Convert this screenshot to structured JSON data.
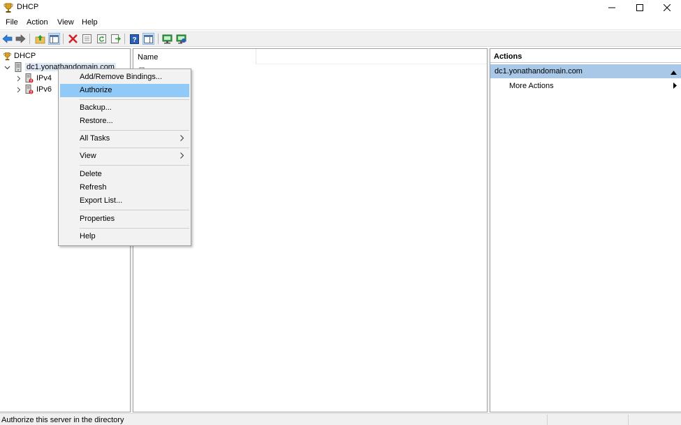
{
  "window": {
    "title": "DHCP",
    "app_icon": "dhcp-trophy-icon"
  },
  "menu": [
    "File",
    "Action",
    "View",
    "Help"
  ],
  "toolbar": [
    "back-icon",
    "forward-icon",
    "up-folder-icon",
    "show-hide-console-tree-icon",
    "delete-icon",
    "properties-icon",
    "refresh-icon",
    "export-list-icon",
    "help-icon",
    "show-hide-action-pane-icon",
    "server-authorize-icon",
    "server-manage-icon"
  ],
  "tree": {
    "root": "DHCP",
    "server": "dc1.yonathandomain.com",
    "children": [
      "IPv4",
      "IPv6"
    ]
  },
  "list": {
    "column_name": "Name"
  },
  "actions": {
    "header": "Actions",
    "section": "dc1.yonathandomain.com",
    "items": [
      "More Actions"
    ]
  },
  "context_menu": {
    "items": [
      {
        "label": "Add/Remove Bindings..."
      },
      {
        "label": "Authorize"
      },
      {
        "label": "Backup..."
      },
      {
        "label": "Restore..."
      },
      {
        "label": "All Tasks"
      },
      {
        "label": "View"
      },
      {
        "label": "Delete"
      },
      {
        "label": "Refresh"
      },
      {
        "label": "Export List..."
      },
      {
        "label": "Properties"
      },
      {
        "label": "Help"
      }
    ]
  },
  "status": {
    "text": "Authorize this server in the directory"
  },
  "colors": {
    "selection": "#91c9f7",
    "actions_section": "#a9c8e8",
    "toolbar_bg": "#f0f0f0"
  }
}
